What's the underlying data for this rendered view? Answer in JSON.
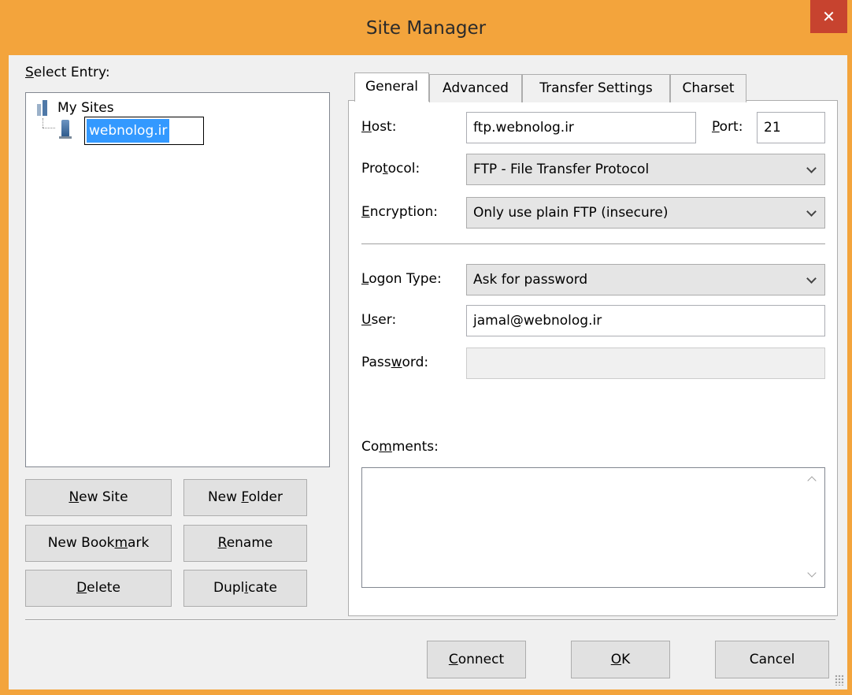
{
  "window": {
    "title": "Site Manager",
    "close_glyph": "✕"
  },
  "left": {
    "select_entry": {
      "pre": "",
      "key": "S",
      "post": "elect Entry:"
    },
    "tree": {
      "root_icon": "server-group-icon",
      "root_label": "My Sites",
      "site_icon": "server-icon",
      "site_label": "webnolog.ir"
    },
    "buttons": {
      "new_site": {
        "pre": "",
        "key": "N",
        "post": "ew Site"
      },
      "new_folder": {
        "pre": "New ",
        "key": "F",
        "post": "older"
      },
      "new_bookmark": {
        "pre": "New Book",
        "key": "m",
        "post": "ark"
      },
      "rename": {
        "pre": "",
        "key": "R",
        "post": "ename"
      },
      "delete": {
        "pre": "",
        "key": "D",
        "post": "elete"
      },
      "duplicate": {
        "pre": "Dupl",
        "key": "i",
        "post": "cate"
      }
    }
  },
  "tabs": {
    "general": "General",
    "advanced": "Advanced",
    "transfer": "Transfer Settings",
    "charset": "Charset",
    "active": "General"
  },
  "general": {
    "host": {
      "pre": "",
      "key": "H",
      "post": "ost:",
      "value": "ftp.webnolog.ir"
    },
    "port": {
      "pre": "",
      "key": "P",
      "post": "ort:",
      "value": "21"
    },
    "protocol": {
      "pre": "Pro",
      "key": "t",
      "post": "ocol:",
      "value": "FTP - File Transfer Protocol"
    },
    "encryption": {
      "pre": "",
      "key": "E",
      "post": "ncryption:",
      "value": "Only use plain FTP (insecure)"
    },
    "logon_type": {
      "pre": "",
      "key": "L",
      "post": "ogon Type:",
      "value": "Ask for password"
    },
    "user": {
      "pre": "",
      "key": "U",
      "post": "ser:",
      "value": "jamal@webnolog.ir"
    },
    "password": {
      "pre": "Pass",
      "key": "w",
      "post": "ord:",
      "value": ""
    },
    "comments": {
      "pre": "Co",
      "key": "m",
      "post": "ments:",
      "value": ""
    }
  },
  "footer": {
    "connect": {
      "pre": "",
      "key": "C",
      "post": "onnect"
    },
    "ok": {
      "pre": "",
      "key": "O",
      "post": "K"
    },
    "cancel": {
      "pre": "Cancel",
      "key": "",
      "post": ""
    }
  },
  "colors": {
    "frame": "#f3a43c",
    "close": "#c7432f",
    "selection": "#3399ff"
  }
}
